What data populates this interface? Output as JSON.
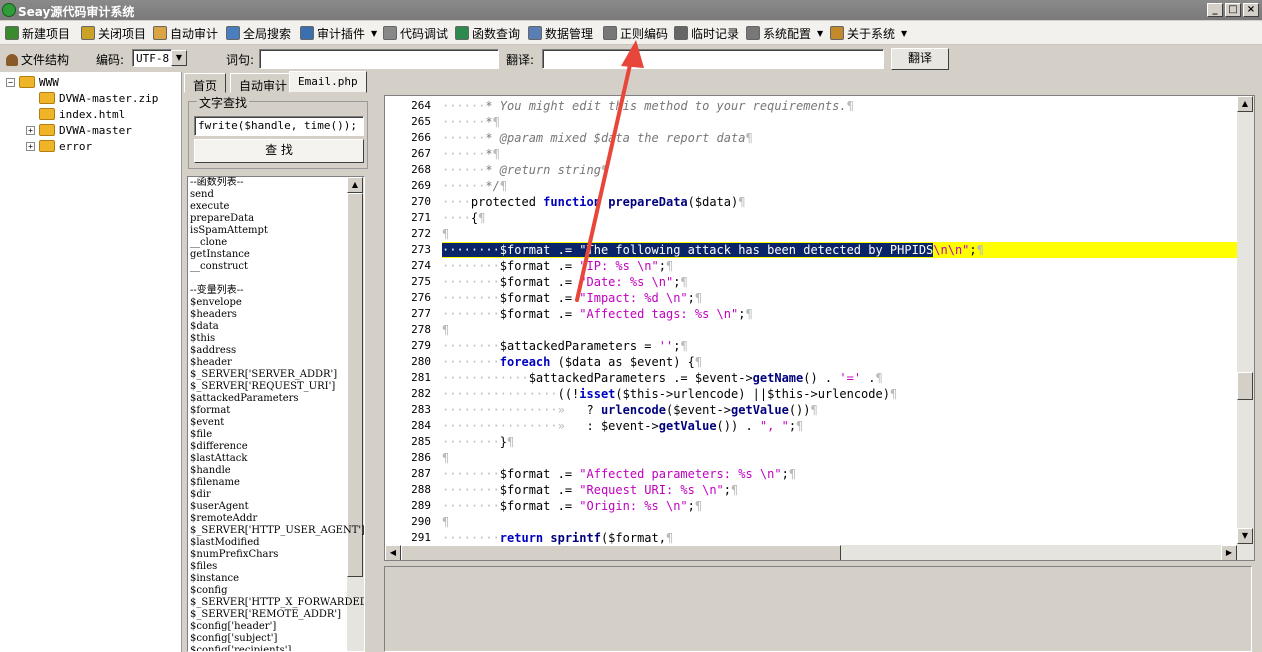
{
  "window": {
    "title": "Seay源代码审计系统"
  },
  "menu": [
    {
      "label": "新建项目",
      "icon": "new-project-icon",
      "color": "#3b8a2e"
    },
    {
      "label": "关闭项目",
      "icon": "close-project-icon",
      "color": "#c9a227"
    },
    {
      "label": "自动审计",
      "icon": "auto-audit-icon",
      "color": "#d9a441"
    },
    {
      "label": "全局搜索",
      "icon": "global-search-icon",
      "color": "#4a7fbf"
    },
    {
      "label": "审计插件",
      "icon": "plugin-icon",
      "color": "#3a6fb0",
      "dropdown": true
    },
    {
      "label": "代码调试",
      "icon": "debug-icon",
      "color": "#888888"
    },
    {
      "label": "函数查询",
      "icon": "function-search-icon",
      "color": "#2d8a4e"
    },
    {
      "label": "数据管理",
      "icon": "data-manage-icon",
      "color": "#5a7db5"
    },
    {
      "label": "正则编码",
      "icon": "regex-encode-icon",
      "color": "#777777"
    },
    {
      "label": "临时记录",
      "icon": "temp-record-icon",
      "color": "#666666"
    },
    {
      "label": "系统配置",
      "icon": "settings-icon",
      "color": "#777777",
      "dropdown": true
    },
    {
      "label": "关于系统",
      "icon": "about-icon",
      "color": "#c48a2a",
      "dropdown": true
    }
  ],
  "toolbar": {
    "file_structure_label": "文件结构",
    "encoding_label": "编码:",
    "encoding_value": "UTF-8",
    "word_label": "词句:",
    "word_value": "",
    "translate_label": "翻译:",
    "translate_value": "",
    "translate_button": "翻译"
  },
  "tree": [
    {
      "label": "WWW",
      "level": 0,
      "toggle": "−"
    },
    {
      "label": "DVWA-master.zip",
      "level": 1,
      "toggle": ""
    },
    {
      "label": "index.html",
      "level": 1,
      "toggle": ""
    },
    {
      "label": "DVWA-master",
      "level": 1,
      "toggle": "+"
    },
    {
      "label": "error",
      "level": 1,
      "toggle": "+"
    }
  ],
  "tabs": [
    {
      "label": "首页",
      "active": false
    },
    {
      "label": "自动审计",
      "active": false
    },
    {
      "label": "Email.php",
      "active": true
    }
  ],
  "search_panel": {
    "legend": "文字查找",
    "query": "fwrite($handle, time());",
    "button": "查 找"
  },
  "function_list": {
    "functions_header": "--函数列表--",
    "functions": [
      "send",
      "execute",
      "prepareData",
      "isSpamAttempt",
      "__clone",
      "getInstance",
      "__construct"
    ],
    "variables_header": "--变量列表--",
    "variables": [
      "$envelope",
      "$headers",
      "$data",
      "$this",
      "$address",
      "$header",
      "$_SERVER['SERVER_ADDR']",
      "$_SERVER['REQUEST_URI']",
      "$attackedParameters",
      "$format",
      "$event",
      "$file",
      "$difference",
      "$lastAttack",
      "$handle",
      "$filename",
      "$dir",
      "$userAgent",
      "$remoteAddr",
      "$_SERVER['HTTP_USER_AGENT']",
      "$lastModified",
      "$numPrefixChars",
      "$files",
      "$instance",
      "$config",
      "$_SERVER['HTTP_X_FORWARDED_",
      "$_SERVER['REMOTE_ADDR']",
      "$config['header']",
      "$config['subject']",
      "$config['recipients']"
    ]
  },
  "editor": {
    "lines": [
      {
        "n": "264",
        "segs": [
          [
            "ws",
            "······"
          ],
          [
            "cm",
            "* You might edit this method to your requirements."
          ],
          [
            "ws",
            "¶"
          ]
        ]
      },
      {
        "n": "265",
        "segs": [
          [
            "ws",
            "······"
          ],
          [
            "cm",
            "*"
          ],
          [
            "ws",
            "¶"
          ]
        ]
      },
      {
        "n": "266",
        "segs": [
          [
            "ws",
            "······"
          ],
          [
            "cm",
            "* @param mixed $data the report data"
          ],
          [
            "ws",
            "¶"
          ]
        ]
      },
      {
        "n": "267",
        "segs": [
          [
            "ws",
            "······"
          ],
          [
            "cm",
            "*"
          ],
          [
            "ws",
            "¶"
          ]
        ]
      },
      {
        "n": "268",
        "segs": [
          [
            "ws",
            "······"
          ],
          [
            "cm",
            "* @return string"
          ],
          [
            "ws",
            "¶"
          ]
        ]
      },
      {
        "n": "269",
        "segs": [
          [
            "ws",
            "······"
          ],
          [
            "cm",
            "*/"
          ],
          [
            "ws",
            "¶"
          ]
        ]
      },
      {
        "n": "270",
        "segs": [
          [
            "ws",
            "····"
          ],
          [
            "var",
            "protected "
          ],
          [
            "kw",
            "function "
          ],
          [
            "fn",
            "prepareData"
          ],
          [
            "var",
            "($data)"
          ],
          [
            "ws",
            "¶"
          ]
        ]
      },
      {
        "n": "271",
        "segs": [
          [
            "ws",
            "····"
          ],
          [
            "var",
            "{"
          ],
          [
            "ws",
            "¶"
          ]
        ]
      },
      {
        "n": "272",
        "segs": [
          [
            "ws",
            "¶"
          ]
        ]
      },
      {
        "n": "273",
        "hl": true,
        "segs": [
          [
            "sel",
            "········$format .= \"The following attack has been detected by PHPIDS"
          ],
          [
            "str",
            "\\n\\n\""
          ],
          [
            "var",
            ";"
          ],
          [
            "ws",
            "¶"
          ]
        ]
      },
      {
        "n": "274",
        "segs": [
          [
            "ws",
            "········"
          ],
          [
            "var",
            "$format .= "
          ],
          [
            "str",
            "\"IP: %s \\n\""
          ],
          [
            "var",
            ";"
          ],
          [
            "ws",
            "¶"
          ]
        ]
      },
      {
        "n": "275",
        "segs": [
          [
            "ws",
            "········"
          ],
          [
            "var",
            "$format .= "
          ],
          [
            "str",
            "\"Date: %s \\n\""
          ],
          [
            "var",
            ";"
          ],
          [
            "ws",
            "¶"
          ]
        ]
      },
      {
        "n": "276",
        "segs": [
          [
            "ws",
            "········"
          ],
          [
            "var",
            "$format .= "
          ],
          [
            "str",
            "\"Impact: %d \\n\""
          ],
          [
            "var",
            ";"
          ],
          [
            "ws",
            "¶"
          ]
        ]
      },
      {
        "n": "277",
        "segs": [
          [
            "ws",
            "········"
          ],
          [
            "var",
            "$format .= "
          ],
          [
            "str",
            "\"Affected tags: %s \\n\""
          ],
          [
            "var",
            ";"
          ],
          [
            "ws",
            "¶"
          ]
        ]
      },
      {
        "n": "278",
        "segs": [
          [
            "ws",
            "¶"
          ]
        ]
      },
      {
        "n": "279",
        "segs": [
          [
            "ws",
            "········"
          ],
          [
            "var",
            "$attackedParameters = "
          ],
          [
            "str",
            "''"
          ],
          [
            "var",
            ";"
          ],
          [
            "ws",
            "¶"
          ]
        ]
      },
      {
        "n": "280",
        "segs": [
          [
            "ws",
            "········"
          ],
          [
            "kw",
            "foreach "
          ],
          [
            "var",
            "($data as $event) {"
          ],
          [
            "ws",
            "¶"
          ]
        ]
      },
      {
        "n": "281",
        "segs": [
          [
            "ws",
            "············"
          ],
          [
            "var",
            "$attackedParameters .= $event->"
          ],
          [
            "fn",
            "getName"
          ],
          [
            "var",
            "() . "
          ],
          [
            "str",
            "'='"
          ],
          [
            "var",
            " ."
          ],
          [
            "ws",
            "¶"
          ]
        ]
      },
      {
        "n": "282",
        "segs": [
          [
            "ws",
            "················"
          ],
          [
            "var",
            "((!"
          ],
          [
            "kw",
            "isset"
          ],
          [
            "var",
            "($this->urlencode) ||$this->urlencode)"
          ],
          [
            "ws",
            "¶"
          ]
        ]
      },
      {
        "n": "283",
        "segs": [
          [
            "ws",
            "················»   "
          ],
          [
            "var",
            "? "
          ],
          [
            "fn",
            "urlencode"
          ],
          [
            "var",
            "($event->"
          ],
          [
            "fn",
            "getValue"
          ],
          [
            "var",
            "())"
          ],
          [
            "ws",
            "¶"
          ]
        ]
      },
      {
        "n": "284",
        "segs": [
          [
            "ws",
            "················»   "
          ],
          [
            "var",
            ": $event->"
          ],
          [
            "fn",
            "getValue"
          ],
          [
            "var",
            "()) . "
          ],
          [
            "str",
            "\", \""
          ],
          [
            "var",
            ";"
          ],
          [
            "ws",
            "¶"
          ]
        ]
      },
      {
        "n": "285",
        "segs": [
          [
            "ws",
            "········"
          ],
          [
            "var",
            "}"
          ],
          [
            "ws",
            "¶"
          ]
        ]
      },
      {
        "n": "286",
        "segs": [
          [
            "ws",
            "¶"
          ]
        ]
      },
      {
        "n": "287",
        "segs": [
          [
            "ws",
            "········"
          ],
          [
            "var",
            "$format .= "
          ],
          [
            "str",
            "\"Affected parameters: %s \\n\""
          ],
          [
            "var",
            ";"
          ],
          [
            "ws",
            "¶"
          ]
        ]
      },
      {
        "n": "288",
        "segs": [
          [
            "ws",
            "········"
          ],
          [
            "var",
            "$format .= "
          ],
          [
            "str",
            "\"Request URI: %s \\n\""
          ],
          [
            "var",
            ";"
          ],
          [
            "ws",
            "¶"
          ]
        ]
      },
      {
        "n": "289",
        "segs": [
          [
            "ws",
            "········"
          ],
          [
            "var",
            "$format .= "
          ],
          [
            "str",
            "\"Origin: %s \\n\""
          ],
          [
            "var",
            ";"
          ],
          [
            "ws",
            "¶"
          ]
        ]
      },
      {
        "n": "290",
        "segs": [
          [
            "ws",
            "¶"
          ]
        ]
      },
      {
        "n": "291",
        "segs": [
          [
            "ws",
            "········"
          ],
          [
            "kw",
            "return "
          ],
          [
            "fn",
            "sprintf"
          ],
          [
            "var",
            "($format,"
          ],
          [
            "ws",
            "¶"
          ]
        ]
      }
    ]
  },
  "colors": {
    "highlight_line": "#ffff00",
    "selection": "#0a246a",
    "comment": "#777777",
    "keyword": "#0000c0",
    "string": "#c000c0",
    "annotation_arrow": "#e8463a"
  }
}
